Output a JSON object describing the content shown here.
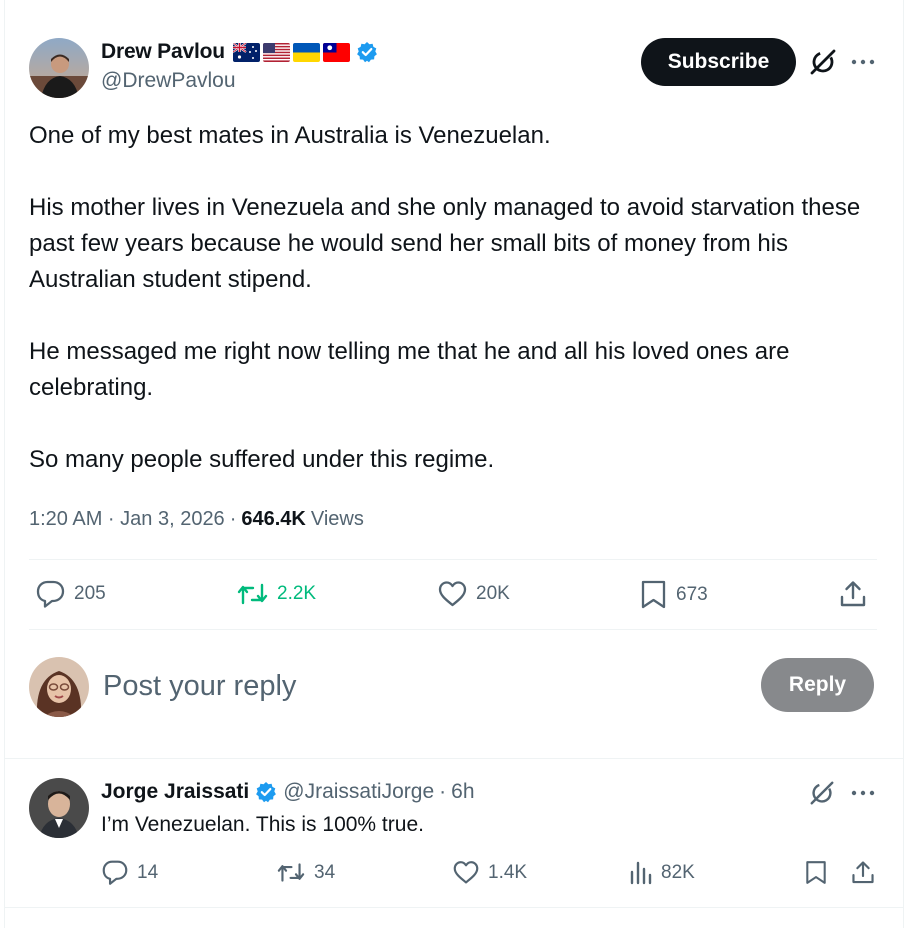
{
  "main_tweet": {
    "author": {
      "display_name": "Drew Pavlou",
      "handle": "@DrewPavlou",
      "flags": [
        "australia-flag",
        "usa-flag",
        "ukraine-flag",
        "taiwan-flag"
      ],
      "verified": true
    },
    "subscribe_label": "Subscribe",
    "paragraphs": [
      "One of my best mates in Australia is Venezuelan.",
      "His mother lives in Venezuela and she only managed to avoid starvation these past few years because he would send her small bits of money from his Australian student stipend.",
      "He messaged me right now telling me that he and all his loved ones are celebrating.",
      "So many people suffered under this regime."
    ],
    "timestamp": "1:20 AM · Jan 3, 2026",
    "views_count": "646.4K",
    "views_label": "Views",
    "actions": {
      "replies": "205",
      "reposts": "2.2K",
      "likes": "20K",
      "bookmarks": "673"
    }
  },
  "composer": {
    "placeholder": "Post your reply",
    "reply_label": "Reply"
  },
  "reply_tweet": {
    "display_name": "Jorge Jraissati",
    "handle": "@JraissatiJorge",
    "time": "6h",
    "text": "I’m Venezuelan. This is 100% true.",
    "actions": {
      "replies": "14",
      "reposts": "34",
      "likes": "1.4K",
      "views": "82K"
    }
  },
  "colors": {
    "text_primary": "#0f1419",
    "text_secondary": "#536471",
    "verified_blue": "#1d9bf0",
    "repost_green": "#00ba7c",
    "button_dark": "#0f1419",
    "reply_button_disabled": "#87898c",
    "divider": "#eff3f4"
  }
}
